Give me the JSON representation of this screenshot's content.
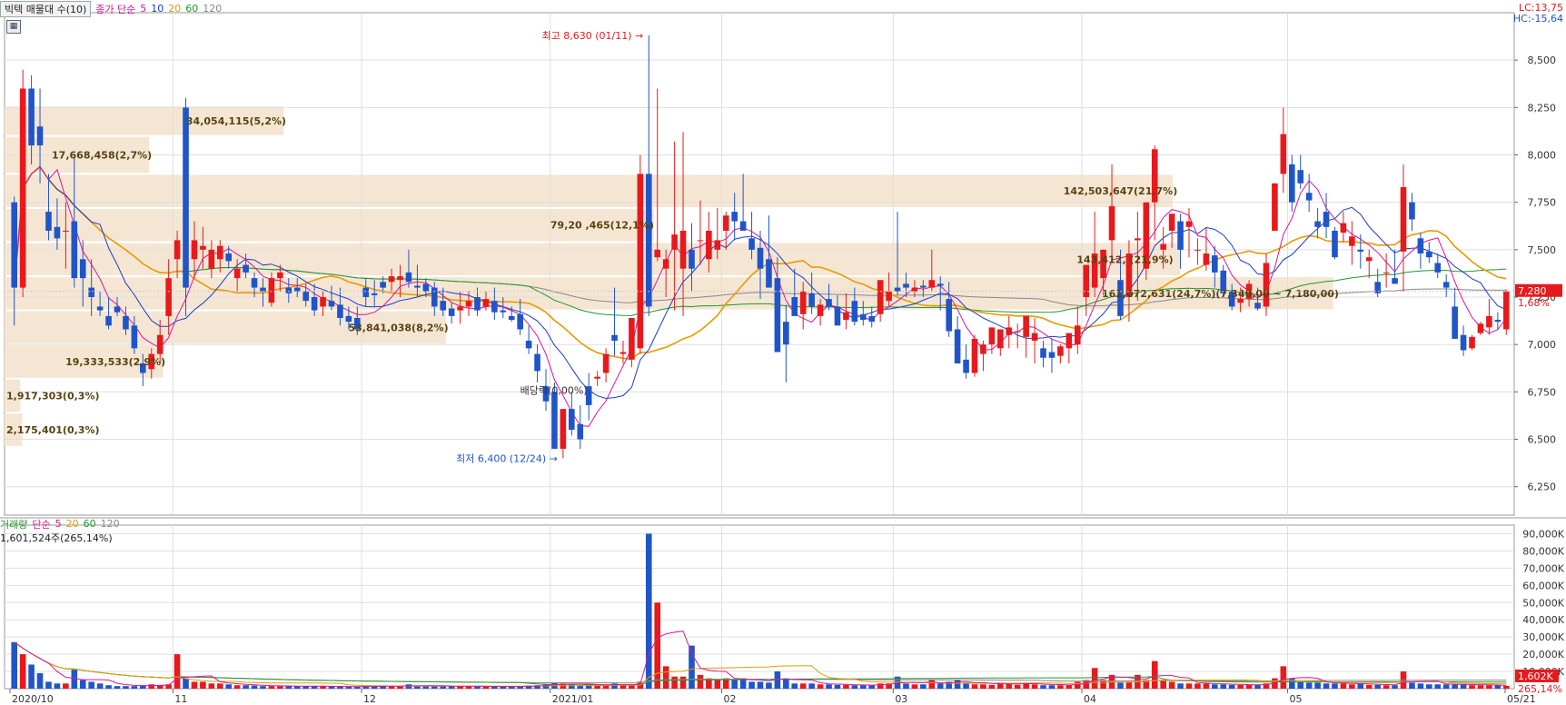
{
  "top_legend": {
    "title": "빅텍 매물대 수(10)",
    "ma_prefix": "종가 단순",
    "ma": [
      "5",
      "10",
      "20",
      "60",
      "120"
    ]
  },
  "lc_label": "LC:13,75",
  "hc_label": "HC:-15,64",
  "bottom_legend": {
    "title": "거래량",
    "ma_prefix": "단순",
    "ma": [
      "5",
      "20",
      "60",
      "120"
    ],
    "current": "1,601,524주(265,14%)"
  },
  "colors": {
    "up": "#e8191c",
    "down": "#1f55c8",
    "ma5": "#e0149c",
    "ma10": "#1a3ccc",
    "ma20": "#e89b00",
    "ma60": "#21972d",
    "ma120": "#888888",
    "profile": "#f5e6d3",
    "grid": "#dfdfdf"
  },
  "chart_data": {
    "type": "candlestick",
    "price_axis": {
      "min": 6100,
      "max": 8750,
      "ticks": [
        "8,500",
        "8,250",
        "8,000",
        "7,750",
        "7,500",
        "7,250",
        "7,000",
        "6,750",
        "6,500",
        "6,250"
      ]
    },
    "volume_axis": {
      "max": 95000,
      "ticks": [
        "90,000K",
        "80,000K",
        "70,000K",
        "60,000K",
        "50,000K",
        "40,000K",
        "30,000K",
        "20,000K",
        "10,000K"
      ]
    },
    "x_labels": [
      "2020/10",
      "11",
      "12",
      "2021/01",
      "02",
      "03",
      "04",
      "05",
      "05/21"
    ],
    "current_price": "7,280",
    "current_change": "1,68%",
    "current_volume": "1,602K",
    "current_volume_ratio": "265,14%",
    "annotations": {
      "high": "최고 8,630 (01/11)",
      "low": "최저 6,400 (12/24)",
      "ex_rights": "배당락(0,00%)"
    },
    "volume_profile": [
      {
        "low": 8100,
        "high": 8260,
        "value": 34054115,
        "label": "34,054,115(5,2%)"
      },
      {
        "low": 7900,
        "high": 8100,
        "value": 17668458,
        "label": "17,668,458(2,7%)"
      },
      {
        "low": 7720,
        "high": 7900,
        "value": 142503647,
        "label": "142,503,647(21,7%)"
      },
      {
        "low": 7540,
        "high": 7720,
        "value": 79200000,
        "label": "79,20 ,465(12,1%)"
      },
      {
        "low": 7360,
        "high": 7540,
        "value": 143412000,
        "label": "143,412,  (21,9%)"
      },
      {
        "low": 7180,
        "high": 7360,
        "value": 162072631,
        "label": "162,072,631(24,7%)(7,340,00 ~ 7,180,00)"
      },
      {
        "low": 7000,
        "high": 7180,
        "value": 53841038,
        "label": "53,841,038(8,2%)"
      },
      {
        "low": 6820,
        "high": 7000,
        "value": 19333533,
        "label": "19,333,533(2,9%)"
      },
      {
        "low": 6640,
        "high": 6820,
        "value": 1917303,
        "label": "1,917,303(0,3%)"
      },
      {
        "low": 6460,
        "high": 6640,
        "value": 2175401,
        "label": "2,175,401(0,3%)"
      }
    ],
    "candles": [
      [
        7750,
        7780,
        7100,
        7300
      ],
      [
        7300,
        8450,
        7250,
        8350
      ],
      [
        8350,
        8420,
        7950,
        8050
      ],
      [
        8150,
        8350,
        7850,
        8050
      ],
      [
        7700,
        7900,
        7550,
        7600
      ],
      [
        7620,
        7770,
        7500,
        7560
      ],
      [
        7600,
        7750,
        7400,
        7600
      ],
      [
        7650,
        8000,
        7300,
        7350
      ],
      [
        7450,
        7550,
        7200,
        7350
      ],
      [
        7300,
        7450,
        7150,
        7250
      ],
      [
        7200,
        7280,
        7150,
        7180
      ],
      [
        7150,
        7250,
        7080,
        7100
      ],
      [
        7200,
        7250,
        7150,
        7170
      ],
      [
        7150,
        7200,
        7050,
        7080
      ],
      [
        7100,
        7150,
        6950,
        6980
      ],
      [
        6900,
        6950,
        6780,
        6850
      ],
      [
        6870,
        6980,
        6820,
        6950
      ],
      [
        6950,
        7130,
        6900,
        7050
      ],
      [
        7150,
        7450,
        7050,
        7350
      ],
      [
        7450,
        7600,
        7350,
        7550
      ],
      [
        8250,
        8300,
        7150,
        7300
      ],
      [
        7450,
        7650,
        7350,
        7550
      ],
      [
        7500,
        7620,
        7400,
        7520
      ],
      [
        7400,
        7550,
        7350,
        7500
      ],
      [
        7450,
        7550,
        7380,
        7520
      ],
      [
        7480,
        7520,
        7400,
        7440
      ],
      [
        7350,
        7450,
        7280,
        7400
      ],
      [
        7420,
        7480,
        7350,
        7380
      ],
      [
        7350,
        7380,
        7250,
        7300
      ],
      [
        7300,
        7350,
        7200,
        7280
      ],
      [
        7220,
        7380,
        7200,
        7350
      ],
      [
        7350,
        7420,
        7280,
        7380
      ],
      [
        7300,
        7350,
        7220,
        7270
      ],
      [
        7300,
        7350,
        7250,
        7280
      ],
      [
        7280,
        7320,
        7200,
        7230
      ],
      [
        7250,
        7320,
        7150,
        7180
      ],
      [
        7200,
        7280,
        7150,
        7250
      ],
      [
        7230,
        7310,
        7180,
        7200
      ],
      [
        7210,
        7300,
        7100,
        7140
      ],
      [
        7150,
        7200,
        7080,
        7120
      ],
      [
        7140,
        7200,
        7050,
        7080
      ],
      [
        7300,
        7350,
        7200,
        7250
      ],
      [
        7270,
        7340,
        7200,
        7260
      ],
      [
        7330,
        7360,
        7270,
        7300
      ],
      [
        7330,
        7400,
        7280,
        7360
      ],
      [
        7340,
        7420,
        7250,
        7360
      ],
      [
        7380,
        7500,
        7300,
        7330
      ],
      [
        7310,
        7420,
        7250,
        7300
      ],
      [
        7320,
        7350,
        7250,
        7280
      ],
      [
        7300,
        7330,
        7150,
        7200
      ],
      [
        7230,
        7300,
        7150,
        7180
      ],
      [
        7190,
        7220,
        7110,
        7150
      ],
      [
        7180,
        7280,
        7110,
        7200
      ],
      [
        7200,
        7280,
        7150,
        7230
      ],
      [
        7250,
        7300,
        7150,
        7180
      ],
      [
        7200,
        7280,
        7180,
        7240
      ],
      [
        7230,
        7300,
        7130,
        7170
      ],
      [
        7180,
        7250,
        7140,
        7170
      ],
      [
        7150,
        7200,
        7120,
        7130
      ],
      [
        7160,
        7240,
        7050,
        7080
      ],
      [
        7020,
        7100,
        6950,
        6980
      ],
      [
        6950,
        7000,
        6800,
        6860
      ],
      [
        6780,
        6870,
        6650,
        6700
      ],
      [
        6750,
        6800,
        6450,
        6450
      ],
      [
        6450,
        6620,
        6400,
        6660
      ],
      [
        6660,
        6750,
        6520,
        6550
      ],
      [
        6580,
        6680,
        6450,
        6500
      ],
      [
        6780,
        6850,
        6600,
        6680
      ],
      [
        6820,
        6860,
        6780,
        6830
      ],
      [
        6850,
        6980,
        6800,
        6950
      ],
      [
        7050,
        7300,
        6940,
        7020
      ],
      [
        6950,
        7020,
        6900,
        6960
      ],
      [
        6920,
        7140,
        6880,
        7140
      ],
      [
        6980,
        8000,
        6950,
        7900
      ],
      [
        7900,
        8630,
        7150,
        7200
      ],
      [
        7460,
        8350,
        7440,
        7500
      ],
      [
        7400,
        7500,
        7250,
        7450
      ],
      [
        7500,
        8070,
        7180,
        7580
      ],
      [
        7400,
        8120,
        7150,
        7600
      ],
      [
        7500,
        7640,
        7280,
        7400
      ],
      [
        7550,
        7760,
        7420,
        7550
      ],
      [
        7450,
        7700,
        7380,
        7600
      ],
      [
        7500,
        7720,
        7450,
        7550
      ],
      [
        7600,
        7700,
        7500,
        7680
      ],
      [
        7700,
        7800,
        7550,
        7650
      ],
      [
        7650,
        7900,
        7600,
        7600
      ],
      [
        7560,
        7700,
        7450,
        7500
      ],
      [
        7510,
        7600,
        7240,
        7400
      ],
      [
        7450,
        7680,
        7320,
        7300
      ],
      [
        7350,
        7460,
        6960,
        6960
      ],
      [
        7120,
        7210,
        6800,
        7000
      ],
      [
        7250,
        7400,
        7200,
        7150
      ],
      [
        7160,
        7330,
        7080,
        7280
      ],
      [
        7270,
        7380,
        7160,
        7200
      ],
      [
        7150,
        7240,
        7100,
        7210
      ],
      [
        7240,
        7320,
        7180,
        7200
      ],
      [
        7200,
        7260,
        7110,
        7100
      ],
      [
        7130,
        7270,
        7080,
        7170
      ],
      [
        7230,
        7300,
        7100,
        7120
      ],
      [
        7160,
        7230,
        7100,
        7130
      ],
      [
        7150,
        7200,
        7090,
        7120
      ],
      [
        7160,
        7330,
        7120,
        7340
      ],
      [
        7230,
        7380,
        7200,
        7280
      ],
      [
        7300,
        7700,
        7260,
        7280
      ],
      [
        7320,
        7380,
        7250,
        7300
      ],
      [
        7280,
        7340,
        7250,
        7300
      ],
      [
        7310,
        7340,
        7250,
        7300
      ],
      [
        7300,
        7500,
        7280,
        7340
      ],
      [
        7320,
        7360,
        7180,
        7310
      ],
      [
        7240,
        7330,
        7040,
        7070
      ],
      [
        7080,
        7150,
        6900,
        6900
      ],
      [
        6920,
        7000,
        6820,
        6850
      ],
      [
        6850,
        7050,
        6830,
        7030
      ],
      [
        6950,
        7020,
        6860,
        7000
      ],
      [
        7000,
        7060,
        6950,
        7090
      ],
      [
        6980,
        7080,
        6940,
        7080
      ],
      [
        7050,
        7150,
        6980,
        7090
      ],
      [
        7070,
        7110,
        6980,
        7070
      ],
      [
        7040,
        7150,
        6930,
        7150
      ],
      [
        7020,
        7140,
        6900,
        7060
      ],
      [
        6980,
        7020,
        6880,
        6930
      ],
      [
        6960,
        7030,
        6850,
        6930
      ],
      [
        6940,
        7000,
        6900,
        6990
      ],
      [
        6980,
        7020,
        6900,
        7060
      ],
      [
        7000,
        7200,
        6950,
        7100
      ],
      [
        7250,
        7400,
        7150,
        7420
      ],
      [
        7300,
        7700,
        7250,
        7480
      ],
      [
        7350,
        7500,
        7260,
        7500
      ],
      [
        7550,
        7950,
        7430,
        7730
      ],
      [
        7340,
        7500,
        7130,
        7150
      ],
      [
        7250,
        7550,
        7120,
        7480
      ],
      [
        7550,
        7700,
        7230,
        7560
      ],
      [
        7400,
        7700,
        7340,
        7750
      ],
      [
        7750,
        8050,
        7550,
        8030
      ],
      [
        7500,
        7620,
        7400,
        7530
      ],
      [
        7600,
        7660,
        7510,
        7690
      ],
      [
        7650,
        7690,
        7400,
        7500
      ],
      [
        7620,
        7720,
        7460,
        7650
      ],
      [
        7500,
        7560,
        7420,
        7500
      ],
      [
        7420,
        7620,
        7390,
        7480
      ],
      [
        7470,
        7520,
        7300,
        7380
      ],
      [
        7390,
        7420,
        7250,
        7270
      ],
      [
        7280,
        7320,
        7180,
        7200
      ],
      [
        7220,
        7300,
        7170,
        7240
      ],
      [
        7240,
        7340,
        7200,
        7320
      ],
      [
        7220,
        7300,
        7180,
        7190
      ],
      [
        7200,
        7480,
        7150,
        7430
      ],
      [
        7600,
        7850,
        7600,
        7850
      ],
      [
        7900,
        8250,
        7800,
        8110
      ],
      [
        7950,
        8000,
        7700,
        7750
      ],
      [
        7920,
        8000,
        7820,
        7850
      ],
      [
        7800,
        7900,
        7700,
        7760
      ],
      [
        7650,
        7720,
        7560,
        7620
      ],
      [
        7700,
        7800,
        7560,
        7620
      ],
      [
        7600,
        7620,
        7450,
        7460
      ],
      [
        7590,
        7700,
        7540,
        7640
      ],
      [
        7520,
        7650,
        7420,
        7570
      ],
      [
        7500,
        7580,
        7400,
        7490
      ],
      [
        7440,
        7500,
        7350,
        7460
      ],
      [
        7330,
        7400,
        7250,
        7270
      ],
      [
        7380,
        7480,
        7300,
        7380
      ],
      [
        7350,
        7500,
        7320,
        7320
      ],
      [
        7490,
        7950,
        7280,
        7830
      ],
      [
        7750,
        7800,
        7600,
        7660
      ],
      [
        7560,
        7590,
        7400,
        7480
      ],
      [
        7490,
        7540,
        7430,
        7460
      ],
      [
        7430,
        7480,
        7350,
        7380
      ],
      [
        7330,
        7370,
        7250,
        7300
      ],
      [
        7200,
        7300,
        7080,
        7030
      ],
      [
        7050,
        7100,
        6940,
        6970
      ],
      [
        6980,
        7050,
        6970,
        7040
      ],
      [
        7060,
        7120,
        7050,
        7110
      ],
      [
        7090,
        7240,
        7050,
        7150
      ],
      [
        7130,
        7170,
        7080,
        7120
      ],
      [
        7080,
        7290,
        7050,
        7280
      ]
    ],
    "volume": [
      27000,
      20000,
      14000,
      9000,
      4000,
      3000,
      3000,
      11000,
      5000,
      4000,
      3000,
      2000,
      1500,
      1500,
      1500,
      2000,
      2500,
      2000,
      2500,
      20000,
      6000,
      4000,
      4000,
      3000,
      3000,
      2500,
      2000,
      2000,
      1800,
      1500,
      1500,
      1500,
      1500,
      1500,
      1400,
      1400,
      1300,
      1300,
      1200,
      1200,
      1200,
      1500,
      1500,
      1400,
      1400,
      1500,
      2500,
      1500,
      1500,
      1600,
      1500,
      1500,
      1400,
      1400,
      1300,
      1300,
      1200,
      1200,
      1200,
      1500,
      1800,
      2000,
      2500,
      3500,
      3000,
      2500,
      2000,
      2500,
      2000,
      2000,
      3000,
      2000,
      2000,
      4000,
      90000,
      50000,
      13000,
      7000,
      7000,
      25000,
      8000,
      6000,
      5000,
      6000,
      5000,
      6000,
      4000,
      4000,
      3500,
      10000,
      6000,
      3000,
      3000,
      3000,
      2500,
      2500,
      2200,
      2200,
      2000,
      2000,
      2000,
      3000,
      3000,
      7000,
      3000,
      2500,
      2500,
      5000,
      3000,
      4000,
      5000,
      3500,
      2500,
      2500,
      2200,
      3500,
      3000,
      2200,
      3500,
      2500,
      2000,
      2000,
      2000,
      2000,
      4000,
      5000,
      12000,
      5000,
      8000,
      3500,
      4000,
      8000,
      5000,
      16000,
      5000,
      4000,
      3000,
      3000,
      3000,
      3000,
      2500,
      2500,
      2200,
      2200,
      2200,
      2200,
      3000,
      6000,
      13000,
      6000,
      4000,
      3500,
      3500,
      3000,
      3000,
      3000,
      2500,
      3000,
      2200,
      2200,
      2000,
      2000,
      10000,
      3500,
      3000,
      2500,
      2500,
      2500,
      2500,
      2500,
      2000,
      2000,
      2000,
      2000,
      1602
    ]
  }
}
